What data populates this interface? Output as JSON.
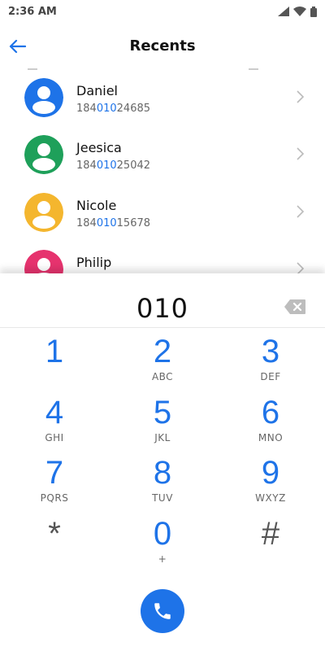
{
  "status_bar": {
    "time": "2:36 AM",
    "icons": [
      "signal-icon",
      "wifi-icon",
      "battery-icon"
    ]
  },
  "header": {
    "title": "Recents",
    "back_icon": "arrow-back-icon"
  },
  "colors": {
    "accent": "#1e73e8",
    "avatar_blue": "#1e73e8",
    "avatar_green": "#1ea05a",
    "avatar_yellow": "#f4b62e",
    "avatar_pink": "#e6336e"
  },
  "recents": [
    {
      "name": "Daniel",
      "number_prefix": "184",
      "number_match": "010",
      "number_suffix": "24685",
      "avatar_color": "#1e73e8"
    },
    {
      "name": "Jeesica",
      "number_prefix": "184",
      "number_match": "010",
      "number_suffix": "25042",
      "avatar_color": "#1ea05a"
    },
    {
      "name": "Nicole",
      "number_prefix": "184",
      "number_match": "010",
      "number_suffix": "15678",
      "avatar_color": "#f4b62e"
    },
    {
      "name": "Philip",
      "avatar_color": "#e6336e"
    }
  ],
  "dialer": {
    "entered_number": "010",
    "keys": [
      {
        "digit": "1",
        "letters": ""
      },
      {
        "digit": "2",
        "letters": "ABC"
      },
      {
        "digit": "3",
        "letters": "DEF"
      },
      {
        "digit": "4",
        "letters": "GHI"
      },
      {
        "digit": "5",
        "letters": "JKL"
      },
      {
        "digit": "6",
        "letters": "MNO"
      },
      {
        "digit": "7",
        "letters": "PQRS"
      },
      {
        "digit": "8",
        "letters": "TUV"
      },
      {
        "digit": "9",
        "letters": "WXYZ"
      },
      {
        "digit": "*",
        "letters": ""
      },
      {
        "digit": "0",
        "letters": "+"
      },
      {
        "digit": "#",
        "letters": ""
      }
    ]
  }
}
